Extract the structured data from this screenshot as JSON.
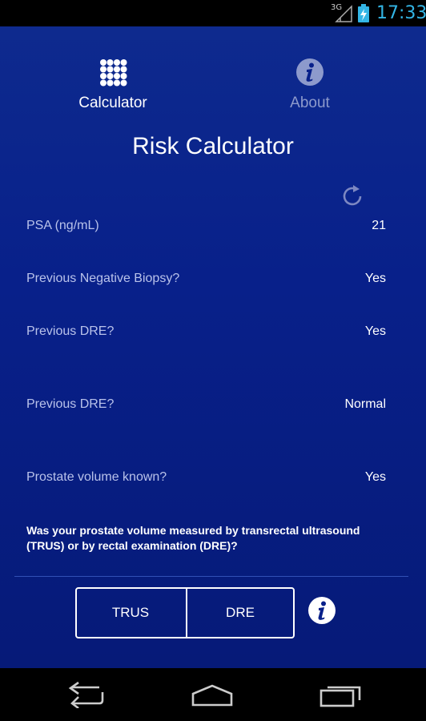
{
  "status_bar": {
    "network": "3G",
    "time": "17:33"
  },
  "tabs": [
    {
      "label": "Calculator",
      "icon": "grid-icon",
      "active": true
    },
    {
      "label": "About",
      "icon": "info-icon",
      "active": false
    }
  ],
  "page_title": "Risk Calculator",
  "fields": [
    {
      "label": "PSA (ng/mL)",
      "value": "21"
    },
    {
      "label": "Previous Negative Biopsy?",
      "value": "Yes"
    },
    {
      "label": "Previous DRE?",
      "value": "Yes"
    },
    {
      "label": "Previous DRE?",
      "value": "Normal"
    },
    {
      "label": "Prostate volume known?",
      "value": "Yes"
    }
  ],
  "question": "Was your prostate volume measured by transrectal ultrasound (TRUS) or by rectal examination (DRE)?",
  "options": [
    {
      "label": "TRUS"
    },
    {
      "label": "DRE"
    }
  ],
  "colors": {
    "background": "#08208a",
    "accent": "#33b5e5"
  }
}
